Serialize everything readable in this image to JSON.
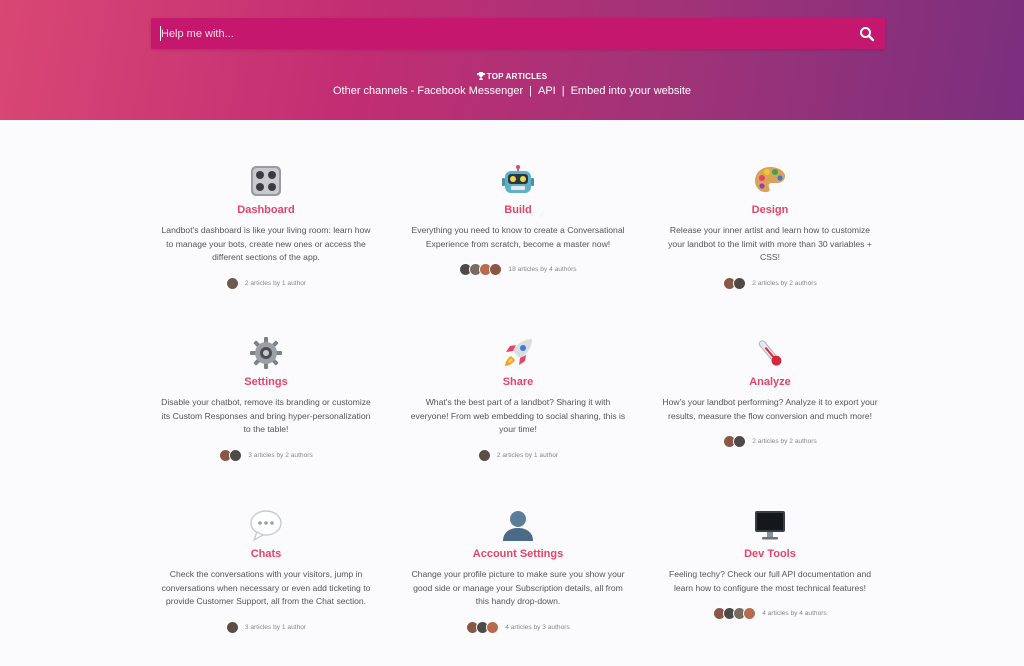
{
  "search": {
    "placeholder": "Help me with..."
  },
  "top_articles": {
    "label": "TOP ARTICLES"
  },
  "channels": {
    "link1": "Other channels - Facebook Messenger",
    "sep": "|",
    "link2": "API",
    "link3": "Embed into your website"
  },
  "colors": {
    "accent": "#e44468",
    "hero_start": "#d94774",
    "hero_end": "#7a2f7e",
    "search_bg": "#c4176d"
  },
  "cards": [
    {
      "icon": "dashboard-icon",
      "title": "Dashboard",
      "desc": "Landbot's dashboard is like your living room: learn how to manage your bots, create new ones or access the different sections of the app.",
      "meta": "2 articles by 1 author",
      "authors": 1
    },
    {
      "icon": "robot-icon",
      "title": "Build",
      "desc": "Everything you need to know to create a Conversational Experience from scratch, become a master now!",
      "meta": "18 articles by 4 authors",
      "authors": 4
    },
    {
      "icon": "palette-icon",
      "title": "Design",
      "desc": "Release your inner artist and learn how to customize your landbot to the limit with more than 30 variables + CSS!",
      "meta": "2 articles by 2 authors",
      "authors": 2
    },
    {
      "icon": "gear-icon",
      "title": "Settings",
      "desc": "Disable your chatbot, remove its branding or customize its Custom Responses and bring hyper-personalization to the table!",
      "meta": "3 articles by 2 authors",
      "authors": 2
    },
    {
      "icon": "rocket-icon",
      "title": "Share",
      "desc": "What's the best part of a landbot? Sharing it with everyone! From web embedding to social sharing, this is your time!",
      "meta": "2 articles by 1 author",
      "authors": 1
    },
    {
      "icon": "thermometer-icon",
      "title": "Analyze",
      "desc": "How's your landbot performing? Analyze it to export your results, measure the flow conversion and much more!",
      "meta": "2 articles by 2 authors",
      "authors": 2
    },
    {
      "icon": "speech-bubble-icon",
      "title": "Chats",
      "desc": "Check the conversations with your visitors, jump in conversations when necessary or even add ticketing to provide Customer Support, all from the Chat section.",
      "meta": "3 articles by 1 author",
      "authors": 1
    },
    {
      "icon": "user-silhouette-icon",
      "title": "Account Settings",
      "desc": "Change your profile picture to make sure you show your good side or manage your Subscription details, all from this handy drop-down.",
      "meta": "4 articles by 3 authors",
      "authors": 3
    },
    {
      "icon": "monitor-icon",
      "title": "Dev Tools",
      "desc": "Feeling techy? Check our full API documentation and learn how to configure the most technical features!",
      "meta": "4 articles by 4 authors",
      "authors": 4
    }
  ]
}
